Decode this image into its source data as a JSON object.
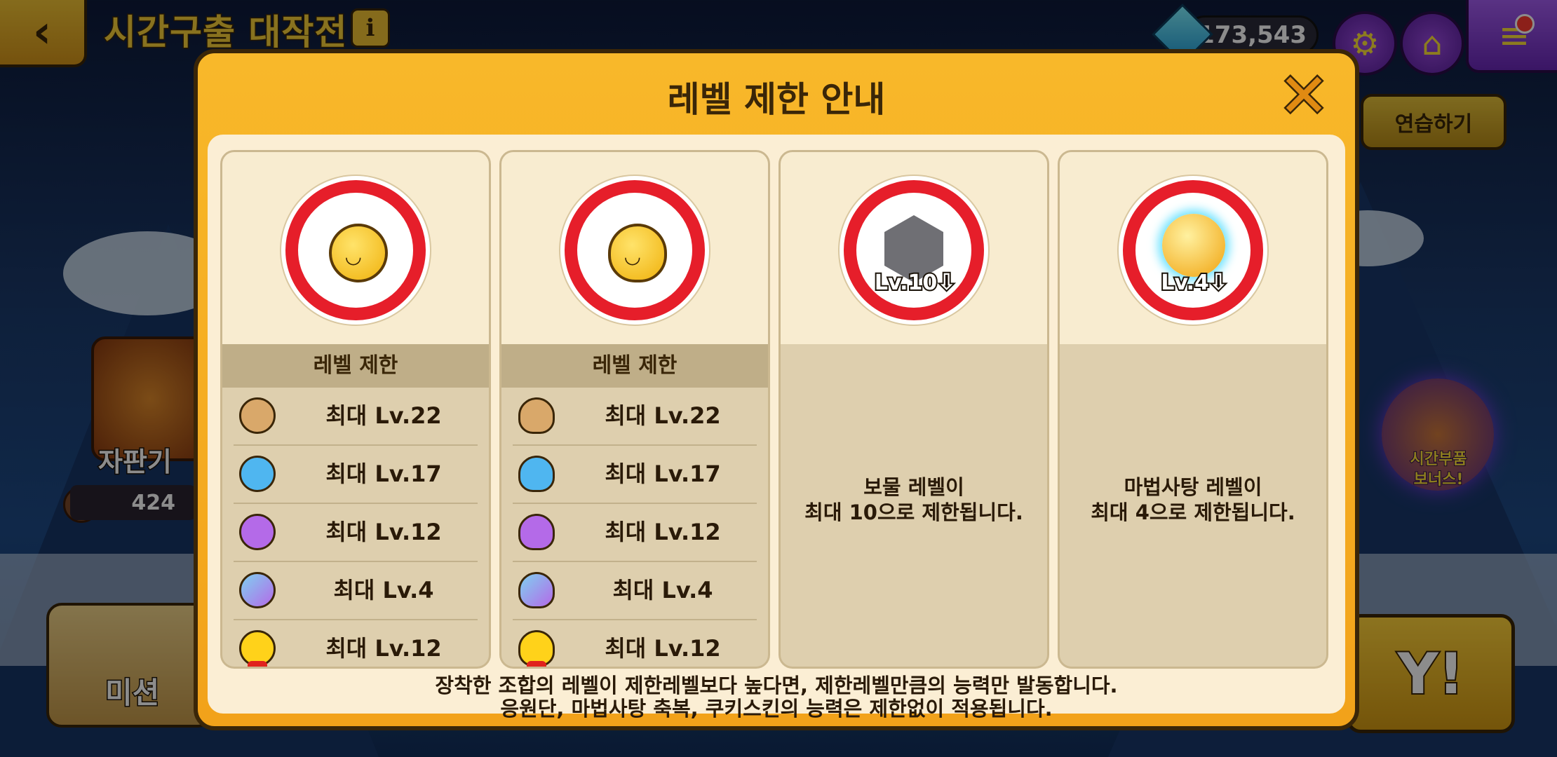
{
  "background": {
    "event_title": "시간구출 대작전!",
    "gems": "173,543",
    "practice_label": "연습하기",
    "vending_label": "자판기",
    "vending_count": "424",
    "mission_label": "미션",
    "play_label": "Y!",
    "bonus_label": "시간부품\n보너스!"
  },
  "dialog": {
    "title": "레벨 제한 안내",
    "close_icon": "close-x",
    "cards": [
      {
        "header": "레벨 제한",
        "rows": [
          {
            "color": "#d9a86a",
            "label": "최대 Lv.22"
          },
          {
            "color": "#4fb6f0",
            "label": "최대 Lv.17"
          },
          {
            "color": "#b46ae8",
            "label": "최대 Lv.12"
          },
          {
            "color": "#7fd0f0",
            "label": "최대 Lv.4"
          },
          {
            "color": "#ffd21a",
            "label": "최대 Lv.12"
          }
        ]
      },
      {
        "header": "레벨 제한",
        "rows": [
          {
            "color": "#d9a86a",
            "label": "최대 Lv.22"
          },
          {
            "color": "#4fb6f0",
            "label": "최대 Lv.17"
          },
          {
            "color": "#b46ae8",
            "label": "최대 Lv.12"
          },
          {
            "color": "#7fd0f0",
            "label": "최대 Lv.4"
          },
          {
            "color": "#ffd21a",
            "label": "최대 Lv.12"
          }
        ]
      },
      {
        "badge": "Lv.10",
        "description": "보물 레벨이\n최대 10으로 제한됩니다."
      },
      {
        "badge": "Lv.4",
        "description": "마법사탕 레벨이\n최대 4으로 제한됩니다."
      }
    ],
    "notes": [
      "장착한 조합의 레벨이 제한레벨보다 높다면, 제한레벨만큼의 능력만 발동합니다.",
      "응원단, 마법사탕 축복, 쿠키스킨의 능력은 제한없이 적용됩니다."
    ]
  },
  "colors": {
    "accent": "#f2a21a",
    "ring": "#e61e2a",
    "panel": "#fbeed4"
  }
}
